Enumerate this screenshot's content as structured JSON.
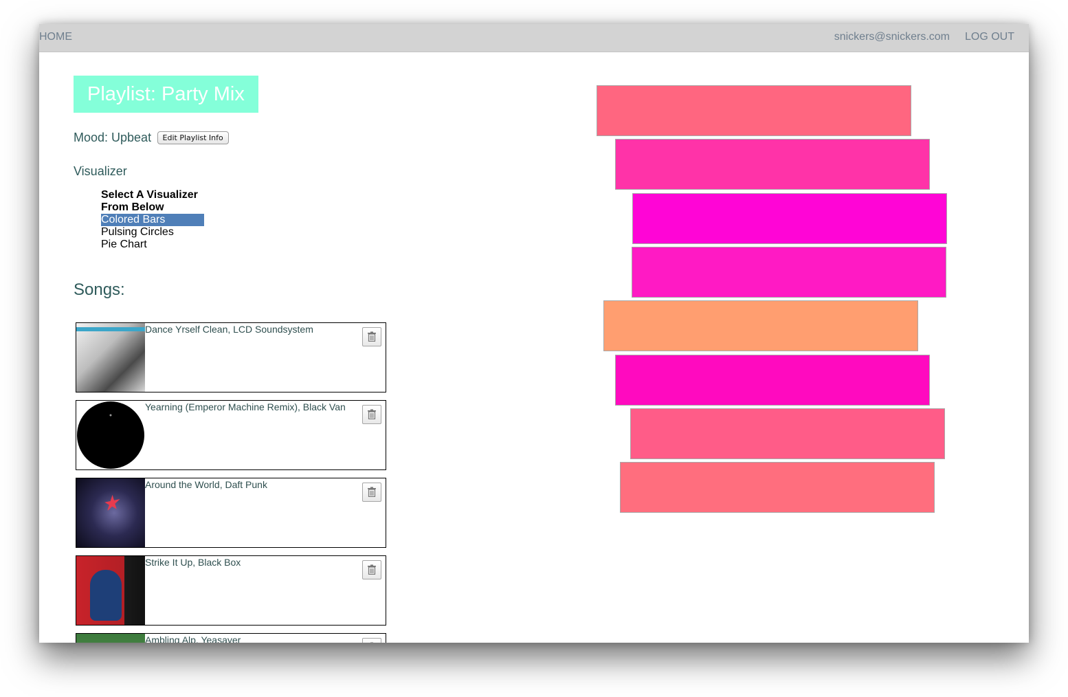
{
  "nav": {
    "home": "HOME",
    "email": "snickers@snickers.com",
    "logout": "LOG OUT"
  },
  "playlist": {
    "title": "Playlist: Party Mix",
    "mood": "Mood: Upbeat",
    "edit_label": "Edit Playlist Info"
  },
  "visualizer": {
    "heading": "Visualizer",
    "group_line1": "Select A Visualizer",
    "group_line2": "From Below",
    "options": [
      "Colored Bars",
      "Pulsing Circles",
      "Pie Chart"
    ],
    "selected": "Colored Bars"
  },
  "songs": {
    "heading": "Songs:",
    "items": [
      {
        "title": "Dance Yrself Clean, LCD Soundsystem"
      },
      {
        "title": "Yearning (Emperor Machine Remix), Black Van"
      },
      {
        "title": "Around the World, Daft Punk"
      },
      {
        "title": "Strike It Up, Black Box"
      },
      {
        "title": "Ambling Alp, Yeasayer"
      }
    ]
  },
  "bar_colors": [
    "#ff6680",
    "#ff33a8",
    "#ff05d6",
    "#ff1ac4",
    "#ff9e70",
    "#ff0abf",
    "#ff5c88",
    "#ff6e7e"
  ]
}
